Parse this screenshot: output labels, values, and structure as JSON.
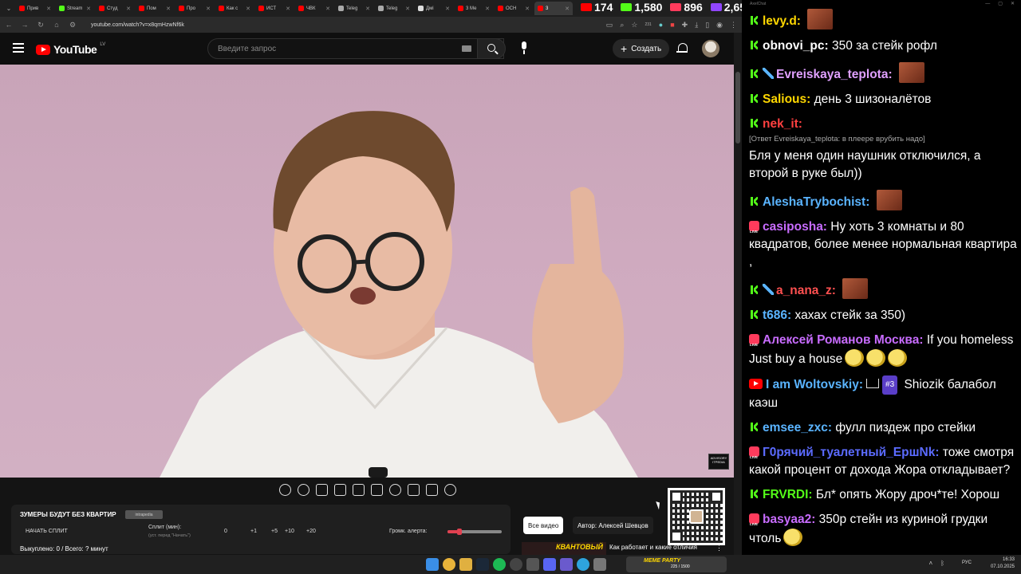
{
  "browser": {
    "tabs": [
      {
        "label": "Прив",
        "color": "#ff0000"
      },
      {
        "label": "Stream",
        "color": "#53fc18"
      },
      {
        "label": "Студ",
        "color": "#ff0000"
      },
      {
        "label": "Пом",
        "color": "#ff0000"
      },
      {
        "label": "Про",
        "color": "#ff0000"
      },
      {
        "label": "Как с",
        "color": "#ff0000"
      },
      {
        "label": "ИСТ",
        "color": "#ff0000"
      },
      {
        "label": "ЧВК",
        "color": "#ff0000"
      },
      {
        "label": "Teleg",
        "color": "#aaaaaa"
      },
      {
        "label": "Teleg",
        "color": "#aaaaaa"
      },
      {
        "label": "Дмі",
        "color": "#dddddd"
      },
      {
        "label": "3 Ме",
        "color": "#ff0000"
      },
      {
        "label": "ОСН",
        "color": "#ff0000"
      },
      {
        "label": "3",
        "color": "#ff0000"
      }
    ],
    "url": "youtube.com/watch?v=x8qmHzwNf6k",
    "ext_badge": "231"
  },
  "stats": [
    {
      "value": "174",
      "color": "#ff0000"
    },
    {
      "value": "1,580",
      "color": "#53fc18"
    },
    {
      "value": "896",
      "color": "#ff3b5c"
    },
    {
      "value": "2,650",
      "color": "#9146ff"
    }
  ],
  "youtube": {
    "logo": "YouTube",
    "region": "LV",
    "search_placeholder": "Введите запрос",
    "create_label": "Создать"
  },
  "video": {
    "advisory": "ADVISORY ITPEDIA"
  },
  "split_panel": {
    "title": "ЗУМЕРЫ БУДУТ БЕЗ КВАРТИР",
    "chip": "intrapedia",
    "start_label": "НАЧАТЬ СПЛИТ",
    "split_label": "Сплит (мин):",
    "split_sub": "(уст. перед \"Начать\")",
    "value": "0",
    "buttons": [
      "+1",
      "+5",
      "+10",
      "+20"
    ],
    "volume_label": "Громк. алерта:",
    "volume_level": 0.22,
    "total": "Выкуплено: 0 / Всего: ? минут"
  },
  "sidebar_buttons": {
    "all_videos": "Все видео",
    "author": "Автор: Алексей Шевцов"
  },
  "recommendation": {
    "thumb_label": "КВАНТОВЫЙ",
    "title": "Как работает и какие отличия"
  },
  "chat": {
    "window_title": "AxelChat",
    "messages": [
      {
        "platform": "kick",
        "nick": "levy.d:",
        "nick_color": "#ffd700",
        "text": "",
        "emote": true
      },
      {
        "platform": "kick",
        "nick": "obnovi_pc:",
        "nick_color": "#ffffff",
        "text": "350 за стейк рофл"
      },
      {
        "platform": "kick",
        "nick": "Evreiskaya_teplota:",
        "nick_color": "#e0a0ff",
        "text": "",
        "sword": true,
        "emote": true
      },
      {
        "platform": "kick",
        "nick": "Salious:",
        "nick_color": "#ffd700",
        "text": "день 3 шизоналётов"
      },
      {
        "platform": "kick",
        "nick": "nek_it:",
        "nick_color": "#ff4040",
        "reply": "[Ответ Evreiskaya_teplota: в плеере врубить надо]",
        "text": "Бля у меня один наушник отключился, а второй в руке был))"
      },
      {
        "platform": "kick",
        "nick": "AleshaTrybochist:",
        "nick_color": "#5ab4ff",
        "text": "",
        "emote": true
      },
      {
        "platform": "live",
        "nick": "casiposha:",
        "nick_color": "#c86cff",
        "text": "Ну хоть 3 комнаты и 80 квадратов, более менее нормальная квартира ,"
      },
      {
        "platform": "kick",
        "nick": "a_nana_z:",
        "nick_color": "#ff5050",
        "text": "",
        "sword": true,
        "emote": true
      },
      {
        "platform": "kick",
        "nick": "t686:",
        "nick_color": "#5ab4ff",
        "text": "хахах стейк за 350)"
      },
      {
        "platform": "live",
        "nick": "Алексей Романов Москва:",
        "nick_color": "#c86cff",
        "text": "If you homeless Just buy a house",
        "emojis": 3
      },
      {
        "platform": "yt",
        "nick": "I am Woltovskiy:",
        "nick_color": "#5ab4ff",
        "rank": "#3",
        "text": "Shiozik балабол каэш"
      },
      {
        "platform": "kick",
        "nick": "emsee_zxc:",
        "nick_color": "#5ab4ff",
        "text": "фулл пиздеж про стейки"
      },
      {
        "platform": "live",
        "nick": "Г0рячий_туалетный_ЕршNk:",
        "nick_color": "#5b6bff",
        "text": "тоже смотря какой процент от дохода Жора откладывает?"
      },
      {
        "platform": "kick",
        "nick": "FRVRDI:",
        "nick_color": "#53fc18",
        "text": "Бл* опять Жору дроч*те! Хорош"
      },
      {
        "platform": "live",
        "nick": "basyaa2:",
        "nick_color": "#c86cff",
        "text": "350р стейн из куриной грудки чтоль",
        "emojis": 1
      }
    ]
  },
  "taskbar": {
    "banner_label": "MEME PARTY",
    "banner_count": "225 / 1500",
    "lang": "РУС",
    "time": "16:33",
    "date": "07.10.2025"
  }
}
